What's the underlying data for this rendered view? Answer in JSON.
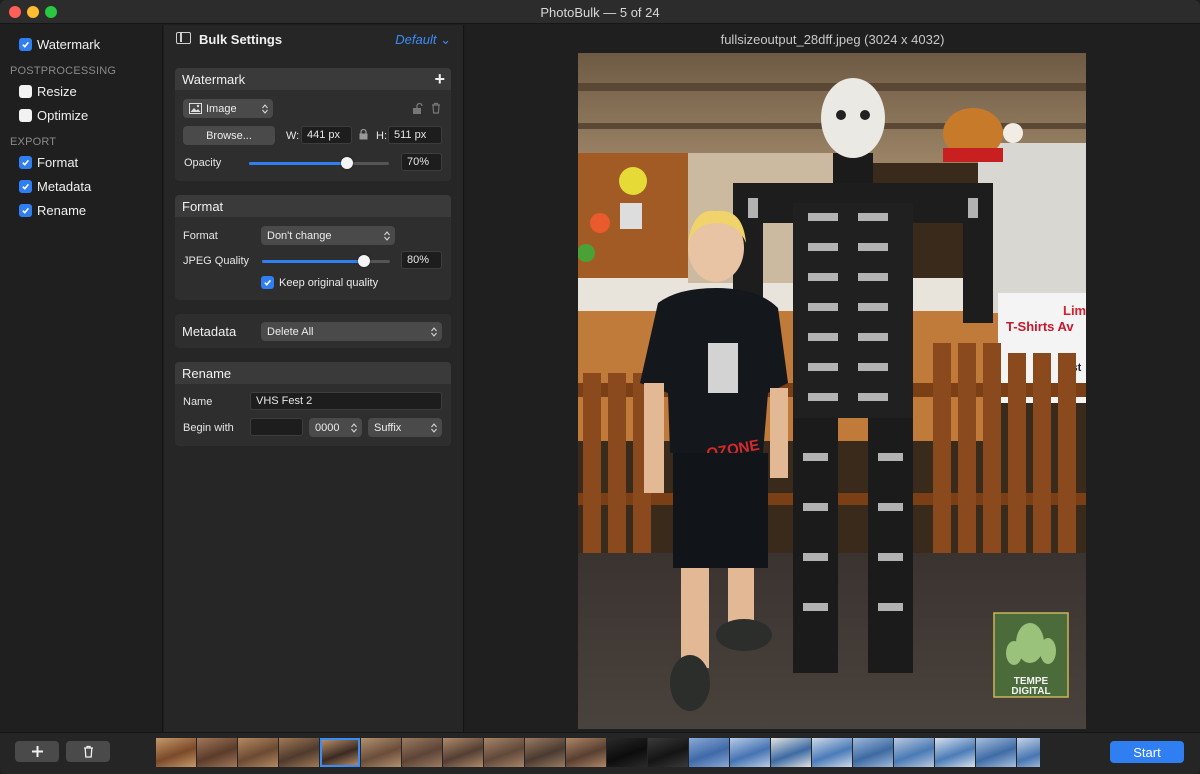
{
  "window": {
    "title": "PhotoBulk — 5 of 24"
  },
  "sidebar": {
    "items": [
      {
        "label": "Watermark",
        "checked": true
      },
      {
        "label": "Resize",
        "checked": false
      },
      {
        "label": "Optimize",
        "checked": false
      },
      {
        "label": "Format",
        "checked": true
      },
      {
        "label": "Metadata",
        "checked": true
      },
      {
        "label": "Rename",
        "checked": true
      }
    ],
    "headings": {
      "postprocessing": "POSTPROCESSING",
      "export": "EXPORT"
    }
  },
  "settings": {
    "title": "Bulk Settings",
    "preset": "Default",
    "watermark": {
      "title": "Watermark",
      "type": "Image",
      "browse_label": "Browse...",
      "w_label": "W:",
      "w_value": "441 px",
      "h_label": "H:",
      "h_value": "511 px",
      "opacity_label": "Opacity",
      "opacity_value": "70%",
      "opacity_level": 0.7
    },
    "format": {
      "title": "Format",
      "format_label": "Format",
      "format_value": "Don't change",
      "quality_label": "JPEG Quality",
      "quality_value": "80%",
      "quality_level": 0.8,
      "keep_original_label": "Keep original quality",
      "keep_original_checked": true
    },
    "metadata": {
      "title": "Metadata",
      "value": "Delete All"
    },
    "rename": {
      "title": "Rename",
      "name_label": "Name",
      "name_value": "VHS Fest 2",
      "begin_label": "Begin with",
      "begin_value": "",
      "counter_value": "0000",
      "position_value": "Suffix"
    }
  },
  "preview": {
    "file_title": "fullsizeoutput_28dff.jpeg (3024 x 4032)",
    "watermark_text_1": "TEMPE",
    "watermark_text_2": "DIGITAL",
    "shirt_text": "OZONE",
    "sign_text_1": "Lim",
    "sign_text_2": "T-Shirts Av",
    "sign_text_3": "Past"
  },
  "bottombar": {
    "start_label": "Start",
    "thumbnail_count": 24,
    "selected_index": 4
  },
  "colors": {
    "accent": "#2f7ff3",
    "preset_link": "#3b8cf6"
  }
}
